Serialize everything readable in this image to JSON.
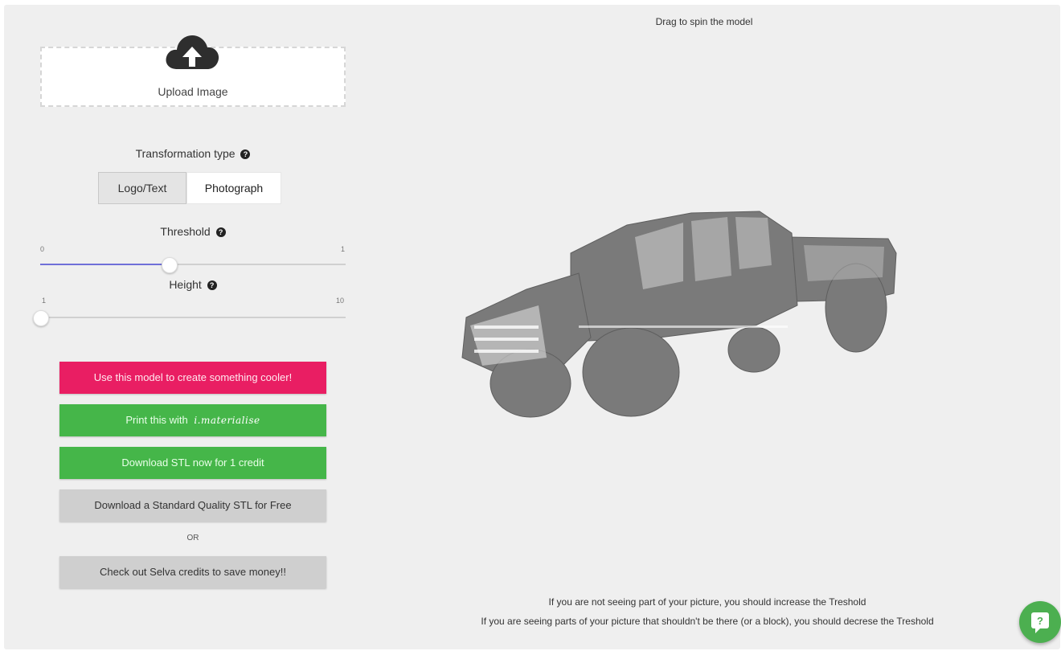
{
  "upload": {
    "label": "Upload Image",
    "icon": "cloud-upload-icon"
  },
  "transformation": {
    "label": "Transformation type",
    "options": [
      "Logo/Text",
      "Photograph"
    ],
    "selected": "Logo/Text"
  },
  "threshold": {
    "label": "Threshold",
    "min": "0",
    "max": "1",
    "value_fraction": 0.42
  },
  "height": {
    "label": "Height",
    "min": "1",
    "max": "10",
    "value_fraction": 0.0
  },
  "buttons": {
    "create_cooler": "Use this model to create something cooler!",
    "print_prefix": "Print this with",
    "print_brand": "i.materialise",
    "download_credit": "Download STL now for 1 credit",
    "download_free": "Download a Standard Quality STL for Free",
    "or_label": "OR",
    "selva_credits": "Check out Selva credits to save money!!"
  },
  "viewer": {
    "hint": "Drag to spin the model",
    "tip_increase": "If you are not seeing part of your picture, you should increase the Treshold",
    "tip_decrease": "If you are seeing parts of your picture that shouldn't be there (or a block), you should decrese the Treshold"
  },
  "colors": {
    "pink": "#e91e63",
    "green": "#45b649",
    "grey": "#cfcfcf",
    "slider_fill": "#6f6fd8",
    "fab": "#4caf50"
  },
  "chat": {
    "icon": "help-chat-icon"
  }
}
